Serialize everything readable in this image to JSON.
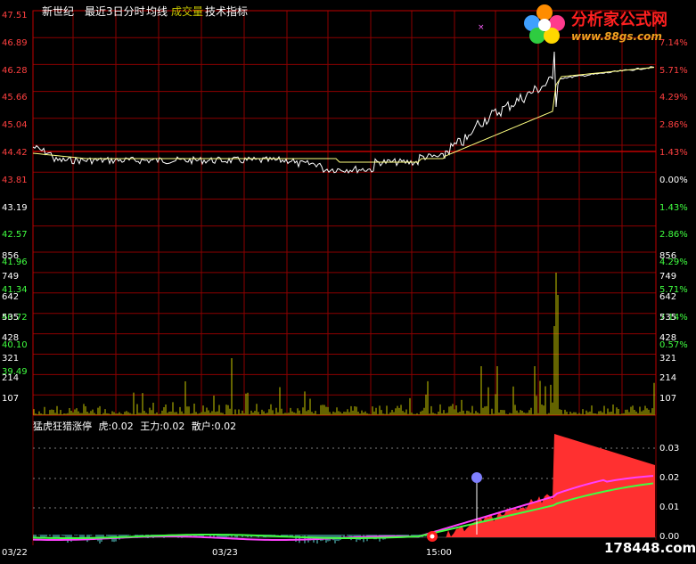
{
  "header": {
    "stock_name": "新世纪",
    "period": "最近3日分时",
    "ma_label": "均线",
    "volume_label": "成交量",
    "tech_label": "技术指标"
  },
  "logo": {
    "title": "分析家公式网",
    "url": "www.88gs.com"
  },
  "watermark": "178448.com",
  "price_axis": {
    "left": [
      "47.51",
      "46.89",
      "46.28",
      "45.66",
      "45.04",
      "44.42",
      "43.81",
      "43.19",
      "42.57",
      "41.96",
      "41.34",
      "40.72",
      "40.10",
      "39.49"
    ],
    "right": [
      "",
      "7.14%",
      "5.71%",
      "4.29%",
      "2.86%",
      "1.43%",
      "0.00%",
      "1.43%",
      "2.86%",
      "4.29%",
      "5.71%",
      "7.14%",
      "0.57%",
      ""
    ]
  },
  "volume_axis": {
    "left": [
      "856",
      "749",
      "642",
      "535",
      "428",
      "321",
      "214",
      "107"
    ],
    "right": [
      "856",
      "749",
      "642",
      "535",
      "428",
      "321",
      "214",
      "107"
    ]
  },
  "indicator": {
    "name": "猛虎狂猎涨停",
    "line1": "虎:0.02",
    "line2": "王力:0.02",
    "line3": "散户:0.02",
    "axis": [
      "0.03",
      "0.02",
      "0.01",
      "0.00"
    ]
  },
  "time_axis": [
    "03/22",
    "03/23",
    "15:00"
  ],
  "colors": {
    "grid": "#8b0000",
    "price": "#ffffff",
    "avg": "#ffff80",
    "volume": "#c8c800",
    "red_area": "#ff3030",
    "magenta": "#ff40ff",
    "green": "#40ff40",
    "cyan": "#60e0e0",
    "up": "#ff4040",
    "down": "#40ff40"
  }
}
